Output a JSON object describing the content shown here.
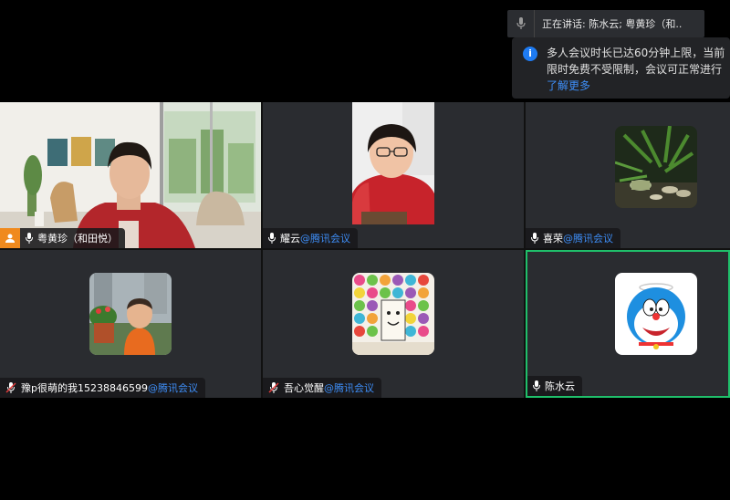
{
  "speaking": {
    "label": "正在讲话:",
    "names": "陈水云; 粤黄珍（和.."
  },
  "notice": {
    "line1": "多人会议时长已达60分钟上限，当前",
    "line2": "限时免费不受限制，会议可正常进行",
    "link": "了解更多"
  },
  "participants": [
    {
      "name": "粤黄珍（和田悦）",
      "tag": "",
      "host": true,
      "muted": false
    },
    {
      "name": "耀云",
      "tag": "@腾讯会议",
      "host": false,
      "muted": false
    },
    {
      "name": "喜荣",
      "tag": "@腾讯会议",
      "host": false,
      "muted": false
    },
    {
      "name": "豫p很萌的我15238846599",
      "tag": "@腾讯会议",
      "host": false,
      "muted": true
    },
    {
      "name": "吾心觉醒",
      "tag": "@腾讯会议",
      "host": false,
      "muted": true
    },
    {
      "name": "陈水云",
      "tag": "",
      "host": false,
      "muted": false,
      "active": true
    }
  ],
  "colors": {
    "accent": "#3e8ef7",
    "active_border": "#1fbf6a",
    "host_badge": "#f08a1e",
    "tile_bg": "#2a2c30"
  }
}
